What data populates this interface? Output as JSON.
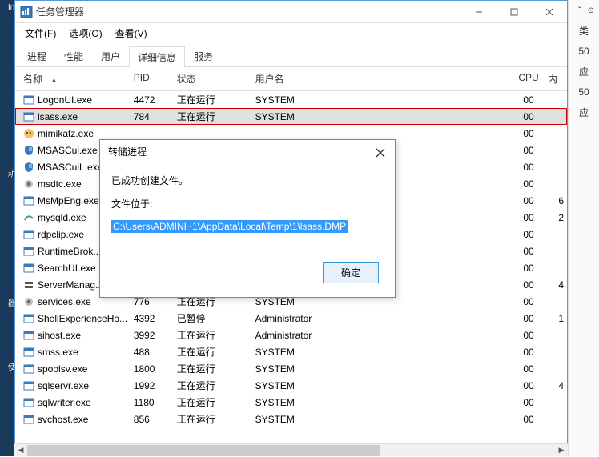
{
  "desktop": {
    "icon0": "Invoke-Ob...",
    "label_ji": "机",
    "label_qi": "器",
    "label_shi": "使"
  },
  "taskmgr": {
    "title": "任务管理器",
    "menu": {
      "file": "文件(F)",
      "options": "选项(O)",
      "view": "查看(V)"
    },
    "tabs": {
      "processes": "进程",
      "performance": "性能",
      "users": "用户",
      "details": "详细信息",
      "services": "服务"
    },
    "headers": {
      "name": "名称",
      "pid": "PID",
      "status": "状态",
      "user": "用户名",
      "cpu": "CPU",
      "other": "内"
    },
    "rows": [
      {
        "icon": "app-blue",
        "name": "LogonUI.exe",
        "pid": "4472",
        "status": "正在运行",
        "user": "SYSTEM",
        "cpu": "00",
        "other": ""
      },
      {
        "icon": "app-blue",
        "name": "lsass.exe",
        "pid": "784",
        "status": "正在运行",
        "user": "SYSTEM",
        "cpu": "00",
        "other": "",
        "hl": true
      },
      {
        "icon": "mimikatz",
        "name": "mimikatz.exe",
        "pid": "",
        "status": "",
        "user": "",
        "cpu": "00",
        "other": ""
      },
      {
        "icon": "shield",
        "name": "MSASCui.exe",
        "pid": "",
        "status": "",
        "user": "",
        "cpu": "00",
        "other": ""
      },
      {
        "icon": "shield",
        "name": "MSASCuiL.exe",
        "pid": "",
        "status": "",
        "user": "",
        "cpu": "00",
        "other": ""
      },
      {
        "icon": "gear",
        "name": "msdtc.exe",
        "pid": "",
        "status": "",
        "user": "",
        "cpu": "00",
        "other": ""
      },
      {
        "icon": "app-blue",
        "name": "MsMpEng.exe",
        "pid": "",
        "status": "",
        "user": "",
        "cpu": "00",
        "other": "6"
      },
      {
        "icon": "mysql",
        "name": "mysqld.exe",
        "pid": "",
        "status": "",
        "user": "",
        "cpu": "00",
        "other": "2"
      },
      {
        "icon": "app-blue",
        "name": "rdpclip.exe",
        "pid": "",
        "status": "",
        "user": "",
        "cpu": "00",
        "other": ""
      },
      {
        "icon": "app-blue",
        "name": "RuntimeBrok...",
        "pid": "",
        "status": "",
        "user": "",
        "cpu": "00",
        "other": ""
      },
      {
        "icon": "app-blue",
        "name": "SearchUI.exe",
        "pid": "",
        "status": "",
        "user": "",
        "cpu": "00",
        "other": ""
      },
      {
        "icon": "server",
        "name": "ServerManag...",
        "pid": "",
        "status": "",
        "user": "",
        "cpu": "00",
        "other": "4"
      },
      {
        "icon": "gear",
        "name": "services.exe",
        "pid": "776",
        "status": "正在运行",
        "user": "SYSTEM",
        "cpu": "00",
        "other": ""
      },
      {
        "icon": "app-blue",
        "name": "ShellExperienceHo...",
        "pid": "4392",
        "status": "已暂停",
        "user": "Administrator",
        "cpu": "00",
        "other": "1"
      },
      {
        "icon": "app-blue",
        "name": "sihost.exe",
        "pid": "3992",
        "status": "正在运行",
        "user": "Administrator",
        "cpu": "00",
        "other": ""
      },
      {
        "icon": "app-blue",
        "name": "smss.exe",
        "pid": "488",
        "status": "正在运行",
        "user": "SYSTEM",
        "cpu": "00",
        "other": ""
      },
      {
        "icon": "app-blue",
        "name": "spoolsv.exe",
        "pid": "1800",
        "status": "正在运行",
        "user": "SYSTEM",
        "cpu": "00",
        "other": ""
      },
      {
        "icon": "app-blue",
        "name": "sqlservr.exe",
        "pid": "1992",
        "status": "正在运行",
        "user": "SYSTEM",
        "cpu": "00",
        "other": "4"
      },
      {
        "icon": "app-blue",
        "name": "sqlwriter.exe",
        "pid": "1180",
        "status": "正在运行",
        "user": "SYSTEM",
        "cpu": "00",
        "other": ""
      },
      {
        "icon": "app-blue",
        "name": "svchost.exe",
        "pid": "856",
        "status": "正在运行",
        "user": "SYSTEM",
        "cpu": "00",
        "other": ""
      }
    ]
  },
  "dialog": {
    "title": "转储进程",
    "line1": "已成功创建文件。",
    "line2": "文件位于:",
    "path": "C:\\Users\\ADMINI~1\\AppData\\Local\\Temp\\1\\lsass.DMP",
    "ok": "确定"
  },
  "right": {
    "char1": "类",
    "char2": "应",
    "num1": "50",
    "num2": "50"
  }
}
